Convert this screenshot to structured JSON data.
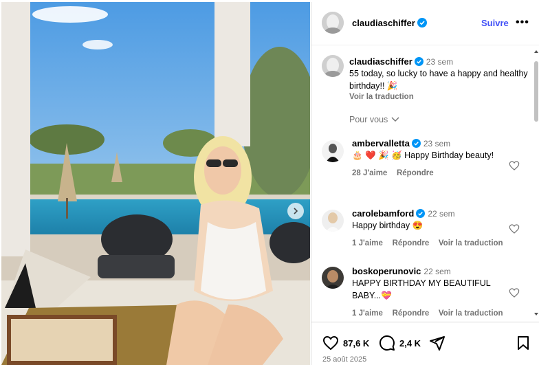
{
  "post": {
    "username": "claudiaschiffer",
    "follow_label": "Suivre",
    "more_label": "•••",
    "caption": {
      "username": "claudiaschiffer",
      "time": "23 sem",
      "text": "55 today, so lucky to have a happy and healthy birthday!! 🎉",
      "translate": "Voir la traduction"
    },
    "for_you_label": "Pour vous"
  },
  "comments": [
    {
      "username": "ambervalletta",
      "verified": true,
      "time": "23 sem",
      "text": "🎂 ❤️ 🎉 🥳 Happy Birthday beauty!",
      "likes": "28 J'aime",
      "reply": "Répondre",
      "translate": ""
    },
    {
      "username": "carolebamford",
      "verified": true,
      "time": "22 sem",
      "text": "Happy birthday 😍",
      "likes": "1 J'aime",
      "reply": "Répondre",
      "translate": "Voir la traduction"
    },
    {
      "username": "boskoperunovic",
      "verified": false,
      "time": "22 sem",
      "text": "HAPPY BIRTHDAY MY BEAUTIFUL BABY...💝",
      "likes": "1 J'aime",
      "reply": "Répondre",
      "translate": "Voir la traduction"
    }
  ],
  "actions": {
    "likes": "87,6 K",
    "comments": "2,4 K"
  },
  "date": "25 août 2025",
  "icons": [
    "verified-badge-icon",
    "heart-icon",
    "comment-icon",
    "share-icon",
    "bookmark-icon",
    "chevron-down-icon",
    "chevron-right-icon"
  ],
  "colors": {
    "accent": "#4150f7",
    "verified": "#0095f6",
    "muted": "#737373"
  }
}
